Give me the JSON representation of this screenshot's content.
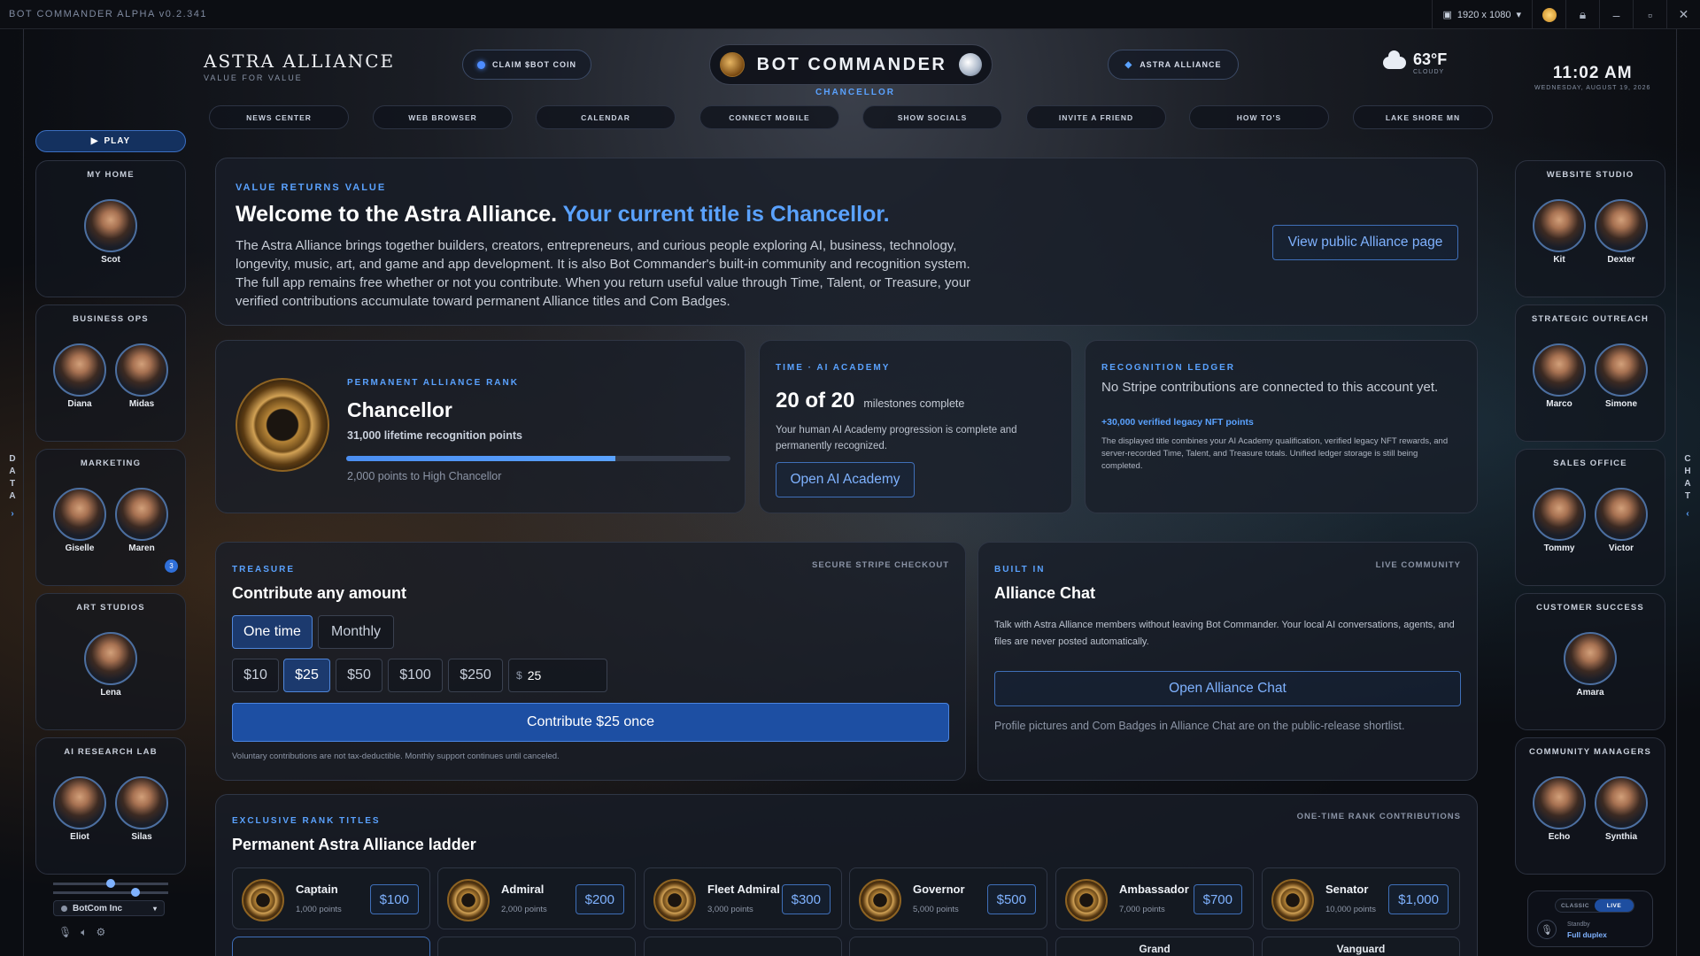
{
  "window": {
    "app_name": "BOT COMMANDER ALPHA v0.2.341",
    "resolution": "1920 x 1080"
  },
  "header": {
    "brand_title": "ASTRA ALLIANCE",
    "brand_subtitle": "VALUE FOR VALUE",
    "claim_button": "CLAIM $BOT COIN",
    "center_title": "BOT COMMANDER",
    "center_subtitle": "CHANCELLOR",
    "alliance_button": "ASTRA ALLIANCE",
    "weather": {
      "temp": "63°F",
      "condition": "CLOUDY"
    },
    "clock": {
      "time": "11:02 AM",
      "date": "WEDNESDAY, AUGUST 19, 2026"
    }
  },
  "nav": [
    "NEWS CENTER",
    "WEB BROWSER",
    "CALENDAR",
    "CONNECT MOBILE",
    "SHOW SOCIALS",
    "INVITE A FRIEND",
    "HOW TO'S",
    "LAKE SHORE MN"
  ],
  "left_rail": {
    "play": "PLAY",
    "edge_label": [
      "D",
      "A",
      "T",
      "A"
    ],
    "edge_arrow": "›",
    "groups": [
      {
        "title": "MY HOME",
        "members": [
          "Scot"
        ]
      },
      {
        "title": "BUSINESS OPS",
        "members": [
          "Diana",
          "Midas"
        ]
      },
      {
        "title": "MARKETING",
        "members": [
          "Giselle",
          "Maren"
        ]
      },
      {
        "title": "ART STUDIOS",
        "members": [
          "Lena"
        ]
      },
      {
        "title": "AI RESEARCH LAB",
        "members": [
          "Eliot",
          "Silas"
        ]
      }
    ],
    "marketing_badge": "3",
    "company_select": "BotCom Inc"
  },
  "right_rail": {
    "edge_label": [
      "C",
      "H",
      "A",
      "T"
    ],
    "edge_arrow": "‹",
    "groups": [
      {
        "title": "WEBSITE STUDIO",
        "members": [
          "Kit",
          "Dexter"
        ]
      },
      {
        "title": "STRATEGIC OUTREACH",
        "members": [
          "Marco",
          "Simone"
        ]
      },
      {
        "title": "SALES OFFICE",
        "members": [
          "Tommy",
          "Victor"
        ]
      },
      {
        "title": "CUSTOMER SUCCESS",
        "members": [
          "Amara"
        ]
      },
      {
        "title": "COMMUNITY MANAGERS",
        "members": [
          "Echo",
          "Synthia"
        ]
      }
    ],
    "mode": {
      "classic": "CLASSIC",
      "live": "LIVE",
      "status": "Standby",
      "duplex": "Full duplex"
    }
  },
  "welcome": {
    "kicker": "VALUE RETURNS VALUE",
    "heading": "Welcome to the Astra Alliance.",
    "heading_accent": "Your current title is Chancellor.",
    "body": "The Astra Alliance brings together builders, creators, entrepreneurs, and curious people exploring AI, business, technology, longevity, music, art, and game and app development. It is also Bot Commander's built-in community and recognition system. The full app remains free whether or not you contribute. When you return useful value through Time, Talent, or Treasure, your verified contributions accumulate toward permanent Alliance titles and Com Badges.",
    "button": "View public Alliance page"
  },
  "rank": {
    "kicker": "PERMANENT ALLIANCE RANK",
    "title": "Chancellor",
    "points": "31,000 lifetime recognition points",
    "progress": 0.7,
    "next": "2,000 points to High Chancellor"
  },
  "academy": {
    "kicker": "TIME · AI ACADEMY",
    "count": "20 of 20",
    "count_label": "milestones complete",
    "body": "Your human AI Academy progression is complete and permanently recognized.",
    "button": "Open AI Academy"
  },
  "ledger": {
    "kicker": "RECOGNITION LEDGER",
    "body": "No Stripe contributions are connected to this account yet.",
    "nft": "+30,000 verified legacy NFT points",
    "note": "The displayed title combines your AI Academy qualification, verified legacy NFT rewards, and server-recorded Time, Talent, and Treasure totals. Unified ledger storage is still being completed."
  },
  "treasure": {
    "kicker": "TREASURE",
    "tag": "SECURE STRIPE CHECKOUT",
    "title": "Contribute any amount",
    "freq": [
      "One time",
      "Monthly"
    ],
    "amounts": [
      "$10",
      "$25",
      "$50",
      "$100",
      "$250"
    ],
    "custom_prefix": "$",
    "custom_value": "25",
    "button": "Contribute $25 once",
    "note": "Voluntary contributions are not tax-deductible. Monthly support continues until canceled."
  },
  "chat": {
    "kicker": "BUILT IN",
    "tag": "LIVE COMMUNITY",
    "title": "Alliance Chat",
    "body": "Talk with Astra Alliance members without leaving Bot Commander. Your local AI conversations, agents, and files are never posted automatically.",
    "button": "Open Alliance Chat",
    "note": "Profile pictures and Com Badges in Alliance Chat are on the public-release shortlist."
  },
  "ranks": {
    "kicker": "EXCLUSIVE RANK TITLES",
    "tag": "ONE-TIME RANK CONTRIBUTIONS",
    "title": "Permanent Astra Alliance ladder",
    "items": [
      {
        "name": "Captain",
        "points": "1,000 points",
        "price": "$100"
      },
      {
        "name": "Admiral",
        "points": "2,000 points",
        "price": "$200"
      },
      {
        "name": "Fleet Admiral",
        "points": "3,000 points",
        "price": "$300"
      },
      {
        "name": "Governor",
        "points": "5,000 points",
        "price": "$500"
      },
      {
        "name": "Ambassador",
        "points": "7,000 points",
        "price": "$700"
      },
      {
        "name": "Senator",
        "points": "10,000 points",
        "price": "$1,000"
      }
    ],
    "next_row": [
      "",
      "",
      "",
      "",
      "Grand",
      "Vanguard"
    ]
  }
}
